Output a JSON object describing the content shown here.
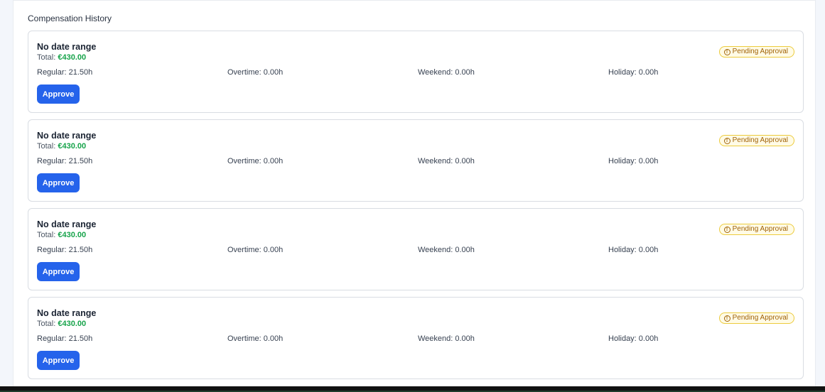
{
  "section": {
    "title": "Compensation History"
  },
  "cards": [
    {
      "title": "No date range",
      "total_label": "Total: ",
      "total_value": "€430.00",
      "status": "Pending Approval",
      "status_icon": "info-circle-icon",
      "regular": "Regular: 21.50h",
      "overtime": "Overtime: 0.00h",
      "weekend": "Weekend: 0.00h",
      "holiday": "Holiday: 0.00h",
      "action_label": "Approve"
    },
    {
      "title": "No date range",
      "total_label": "Total: ",
      "total_value": "€430.00",
      "status": "Pending Approval",
      "status_icon": "info-circle-icon",
      "regular": "Regular: 21.50h",
      "overtime": "Overtime: 0.00h",
      "weekend": "Weekend: 0.00h",
      "holiday": "Holiday: 0.00h",
      "action_label": "Approve"
    },
    {
      "title": "No date range",
      "total_label": "Total: ",
      "total_value": "€430.00",
      "status": "Pending Approval",
      "status_icon": "info-circle-icon",
      "regular": "Regular: 21.50h",
      "overtime": "Overtime: 0.00h",
      "weekend": "Weekend: 0.00h",
      "holiday": "Holiday: 0.00h",
      "action_label": "Approve"
    },
    {
      "title": "No date range",
      "total_label": "Total: ",
      "total_value": "€430.00",
      "status": "Pending Approval",
      "status_icon": "info-circle-icon",
      "regular": "Regular: 21.50h",
      "overtime": "Overtime: 0.00h",
      "weekend": "Weekend: 0.00h",
      "holiday": "Holiday: 0.00h",
      "action_label": "Approve"
    }
  ],
  "colors": {
    "accent": "#2563eb",
    "total_value": "#16a34a",
    "pending_badge_text": "#a16207",
    "pending_badge_border": "#eccb3d",
    "pending_badge_bg": "#fffbe6"
  }
}
